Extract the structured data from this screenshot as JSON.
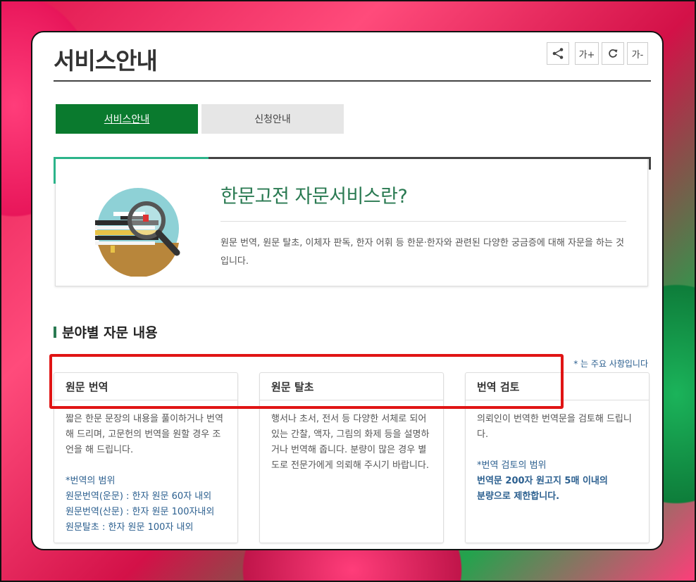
{
  "page": {
    "title": "서비스안내",
    "tools": {
      "font_up": "가+",
      "refresh": "C",
      "font_down": "가-"
    }
  },
  "tabs": [
    {
      "label": "서비스안내",
      "active": true
    },
    {
      "label": "신청안내",
      "active": false
    }
  ],
  "intro": {
    "heading": "한문고전 자문서비스란?",
    "text": "원문 번역, 원문 탈초, 이체자 판독, 한자 어휘 등 한문·한자와 관련된 다양한 궁금증에 대해 자문을 하는 것입니다."
  },
  "section": {
    "title": "분야별 자문 내용",
    "note": "* 는 주요 사항입니다"
  },
  "columns": [
    {
      "title": "원문 번역",
      "desc": "짧은 한문 문장의 내용을 풀이하거나 번역해 드리며, 고문헌의 번역을 원할 경우 조언을 해 드립니다.",
      "scope_title": "*번역의 범위",
      "scope_lines": [
        "원문번역(운문) : 한자 원문 60자 내외",
        "원문번역(산문) : 한자 원문 100자내외",
        "원문탈초 : 한자 원문 100자 내외"
      ]
    },
    {
      "title": "원문 탈초",
      "desc": "행서나 초서, 전서 등 다양한 서체로 되어 있는 간찰, 액자, 그림의 화제 등을 설명하거나 번역해 줍니다. 분량이 많은 경우 별도로 전문가에게 의뢰해 주시기 바랍니다."
    },
    {
      "title": "번역 검토",
      "desc": "의뢰인이 번역한 번역문을 검토해 드립니다.",
      "scope_title": "*번역 검토의 범위",
      "scope_lines": [
        "번역문 200자 원고지 5매 이내의",
        "분량으로 제한합니다."
      ]
    }
  ],
  "colors": {
    "accent_green": "#0a7a2e",
    "teal": "#2cb48a",
    "highlight_red": "#e01414",
    "link_blue": "#2b5f8f"
  }
}
